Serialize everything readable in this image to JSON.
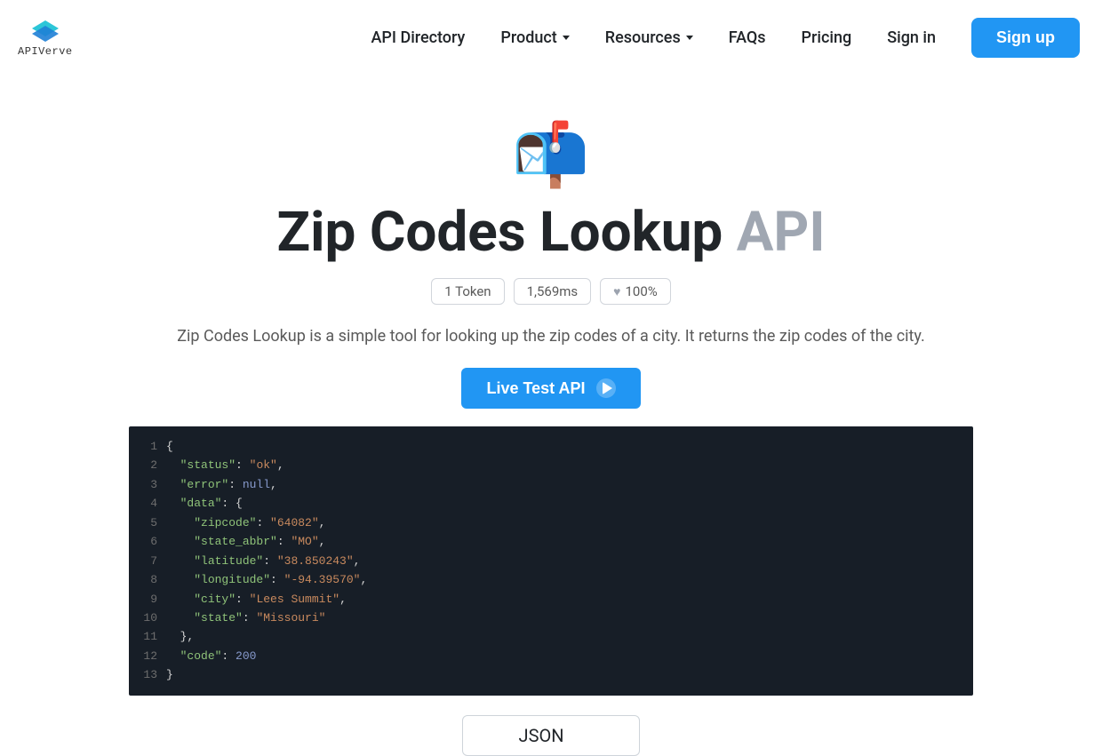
{
  "brand": {
    "name": "APIVerve"
  },
  "nav": {
    "api_directory": "API Directory",
    "product": "Product",
    "resources": "Resources",
    "faqs": "FAQs",
    "pricing": "Pricing",
    "signin": "Sign in",
    "signup": "Sign up"
  },
  "hero": {
    "icon": "📬",
    "title_main": "Zip Codes Lookup ",
    "title_accent": "API",
    "badge_token": "1 Token",
    "badge_latency": "1,569ms",
    "badge_uptime": "100%",
    "description": "Zip Codes Lookup is a simple tool for looking up the zip codes of a city. It returns the zip codes of the city.",
    "live_test_label": "Live Test API"
  },
  "code": {
    "lines": [
      {
        "n": "1",
        "indent": "",
        "tokens": [
          {
            "t": "punc",
            "v": "{"
          }
        ]
      },
      {
        "n": "2",
        "indent": "  ",
        "tokens": [
          {
            "t": "key",
            "v": "\"status\""
          },
          {
            "t": "punc",
            "v": ": "
          },
          {
            "t": "str",
            "v": "\"ok\""
          },
          {
            "t": "punc",
            "v": ","
          }
        ]
      },
      {
        "n": "3",
        "indent": "  ",
        "tokens": [
          {
            "t": "key",
            "v": "\"error\""
          },
          {
            "t": "punc",
            "v": ": "
          },
          {
            "t": "null",
            "v": "null"
          },
          {
            "t": "punc",
            "v": ","
          }
        ]
      },
      {
        "n": "4",
        "indent": "  ",
        "tokens": [
          {
            "t": "key",
            "v": "\"data\""
          },
          {
            "t": "punc",
            "v": ": {"
          }
        ]
      },
      {
        "n": "5",
        "indent": "    ",
        "tokens": [
          {
            "t": "key",
            "v": "\"zipcode\""
          },
          {
            "t": "punc",
            "v": ": "
          },
          {
            "t": "str",
            "v": "\"64082\""
          },
          {
            "t": "punc",
            "v": ","
          }
        ]
      },
      {
        "n": "6",
        "indent": "    ",
        "tokens": [
          {
            "t": "key",
            "v": "\"state_abbr\""
          },
          {
            "t": "punc",
            "v": ": "
          },
          {
            "t": "str",
            "v": "\"MO\""
          },
          {
            "t": "punc",
            "v": ","
          }
        ]
      },
      {
        "n": "7",
        "indent": "    ",
        "tokens": [
          {
            "t": "key",
            "v": "\"latitude\""
          },
          {
            "t": "punc",
            "v": ": "
          },
          {
            "t": "str",
            "v": "\"38.850243\""
          },
          {
            "t": "punc",
            "v": ","
          }
        ]
      },
      {
        "n": "8",
        "indent": "    ",
        "tokens": [
          {
            "t": "key",
            "v": "\"longitude\""
          },
          {
            "t": "punc",
            "v": ": "
          },
          {
            "t": "str",
            "v": "\"-94.39570\""
          },
          {
            "t": "punc",
            "v": ","
          }
        ]
      },
      {
        "n": "9",
        "indent": "    ",
        "tokens": [
          {
            "t": "key",
            "v": "\"city\""
          },
          {
            "t": "punc",
            "v": ": "
          },
          {
            "t": "str",
            "v": "\"Lees Summit\""
          },
          {
            "t": "punc",
            "v": ","
          }
        ]
      },
      {
        "n": "10",
        "indent": "    ",
        "tokens": [
          {
            "t": "key",
            "v": "\"state\""
          },
          {
            "t": "punc",
            "v": ": "
          },
          {
            "t": "str",
            "v": "\"Missouri\""
          }
        ]
      },
      {
        "n": "11",
        "indent": "  ",
        "tokens": [
          {
            "t": "punc",
            "v": "},"
          }
        ]
      },
      {
        "n": "12",
        "indent": "  ",
        "tokens": [
          {
            "t": "key",
            "v": "\"code\""
          },
          {
            "t": "punc",
            "v": ": "
          },
          {
            "t": "num",
            "v": "200"
          }
        ]
      },
      {
        "n": "13",
        "indent": "",
        "tokens": [
          {
            "t": "punc",
            "v": "}"
          }
        ]
      }
    ]
  },
  "format_select": {
    "selected": "JSON"
  }
}
